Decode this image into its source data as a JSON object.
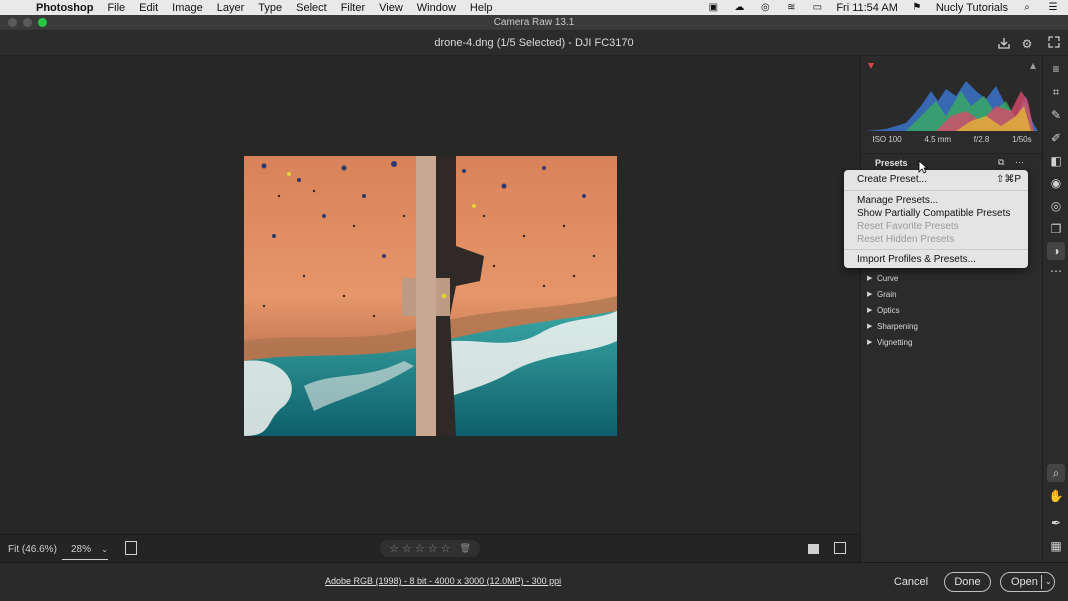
{
  "menubar": {
    "app": "Photoshop",
    "items": [
      "File",
      "Edit",
      "Image",
      "Layer",
      "Type",
      "Select",
      "Filter",
      "View",
      "Window",
      "Help"
    ],
    "time": "Fri 11:54 AM",
    "user": "Nucly Tutorials"
  },
  "window": {
    "title": "Camera Raw 13.1"
  },
  "header": {
    "filename": "drone-4.dng (1/5 Selected)  -  DJI FC3170"
  },
  "view": {
    "fit": "Fit (46.6%)",
    "zoom": "28%"
  },
  "rating": {
    "stars": 0,
    "max": 5
  },
  "histogram": {
    "exif": {
      "iso": "ISO 100",
      "focal": "4.5 mm",
      "aperture": "f/2.8",
      "shutter": "1/50s"
    }
  },
  "presets": {
    "title": "Presets"
  },
  "menu": {
    "create_preset": "Create Preset...",
    "create_shortcut": "⇧⌘P",
    "manage_presets": "Manage Presets...",
    "show_partial": "Show Partially Compatible Presets",
    "reset_favorite": "Reset Favorite Presets",
    "reset_hidden": "Reset Hidden Presets",
    "import_profiles": "Import Profiles & Presets..."
  },
  "sections": [
    "Curve",
    "Grain",
    "Optics",
    "Sharpening",
    "Vignetting"
  ],
  "bottom": {
    "info": "Adobe RGB (1998) - 8 bit - 4000 x 3000 (12.0MP) - 300 ppi",
    "cancel": "Cancel",
    "done": "Done",
    "open": "Open"
  },
  "colors": {
    "menubar_bg": "#e9e9e9",
    "panel_bg": "#2b2b2b",
    "canvas_bg": "#272727",
    "clip_warning": "#e04040",
    "close": "#ff5f57",
    "minimize": "#febc2e",
    "zoom": "#28c840"
  }
}
